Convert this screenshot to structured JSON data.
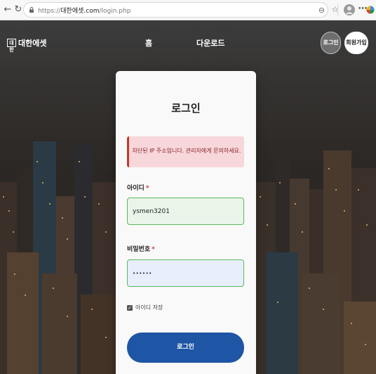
{
  "browser": {
    "url_scheme": "https://",
    "url_host": "대한에셋.com",
    "url_path": "/login.php",
    "back_icon": "back-arrow-icon",
    "refresh_icon": "refresh-icon"
  },
  "header": {
    "brand_mark": "대한",
    "brand_name": "대한에셋",
    "nav": [
      "홈",
      "다운로드"
    ],
    "login_label": "로그인",
    "join_label": "회원가입"
  },
  "form": {
    "title": "로그인",
    "alert": "차단된 IP 주소입니다. 관리자에게 문의하세요.",
    "username_label": "아이디",
    "username_value": "ysmen3201",
    "password_label": "비밀번호",
    "password_mask": "••••••",
    "required_mark": "*",
    "remember_label": "아이디 저장",
    "remember_checked": true,
    "submit_label": "로그인"
  },
  "colors": {
    "primary": "#1f55a5",
    "alert_bg": "#f8d7da",
    "alert_border": "#c0392b",
    "input_border": "#5cb85c"
  }
}
